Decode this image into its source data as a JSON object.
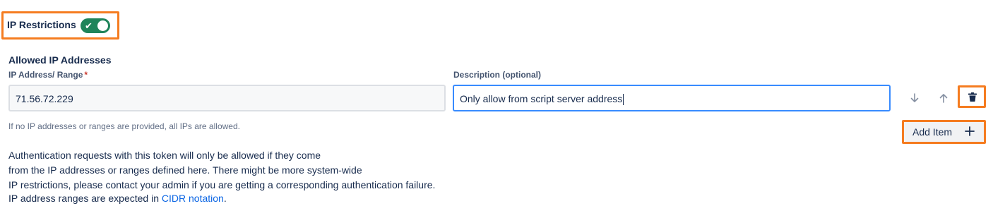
{
  "ip_restrictions": {
    "label": "IP Restrictions",
    "toggle_checked": true,
    "toggle_icon": "check-icon"
  },
  "section_title": "Allowed IP Addresses",
  "fields": {
    "ip_label": "IP Address/ Range",
    "ip_required_marker": "*",
    "ip_value": "71.56.72.229",
    "description_label": "Description (optional)",
    "description_value": "Only allow from script server address"
  },
  "row_actions": {
    "move_down_icon": "arrow-down-icon",
    "move_up_icon": "arrow-up-icon",
    "delete_icon": "trash-icon"
  },
  "help_text": "If no IP addresses or ranges are provided, all IPs are allowed.",
  "add_item": {
    "label": "Add Item",
    "icon": "plus-icon"
  },
  "description": {
    "line1": "Authentication requests with this token will only be allowed if they come",
    "line2": "from the IP addresses or ranges defined here. There might be more system-wide",
    "line3": "IP restrictions, please contact your admin if you are getting a corresponding authentication failure.",
    "line4_prefix": "IP address ranges are expected in ",
    "line4_link": "CIDR notation",
    "line4_suffix": "."
  },
  "colors": {
    "toggle_on": "#1f845a",
    "focus_border": "#388bff",
    "highlight": "#f57c20",
    "link": "#0c66e4",
    "required": "#c9372c"
  }
}
